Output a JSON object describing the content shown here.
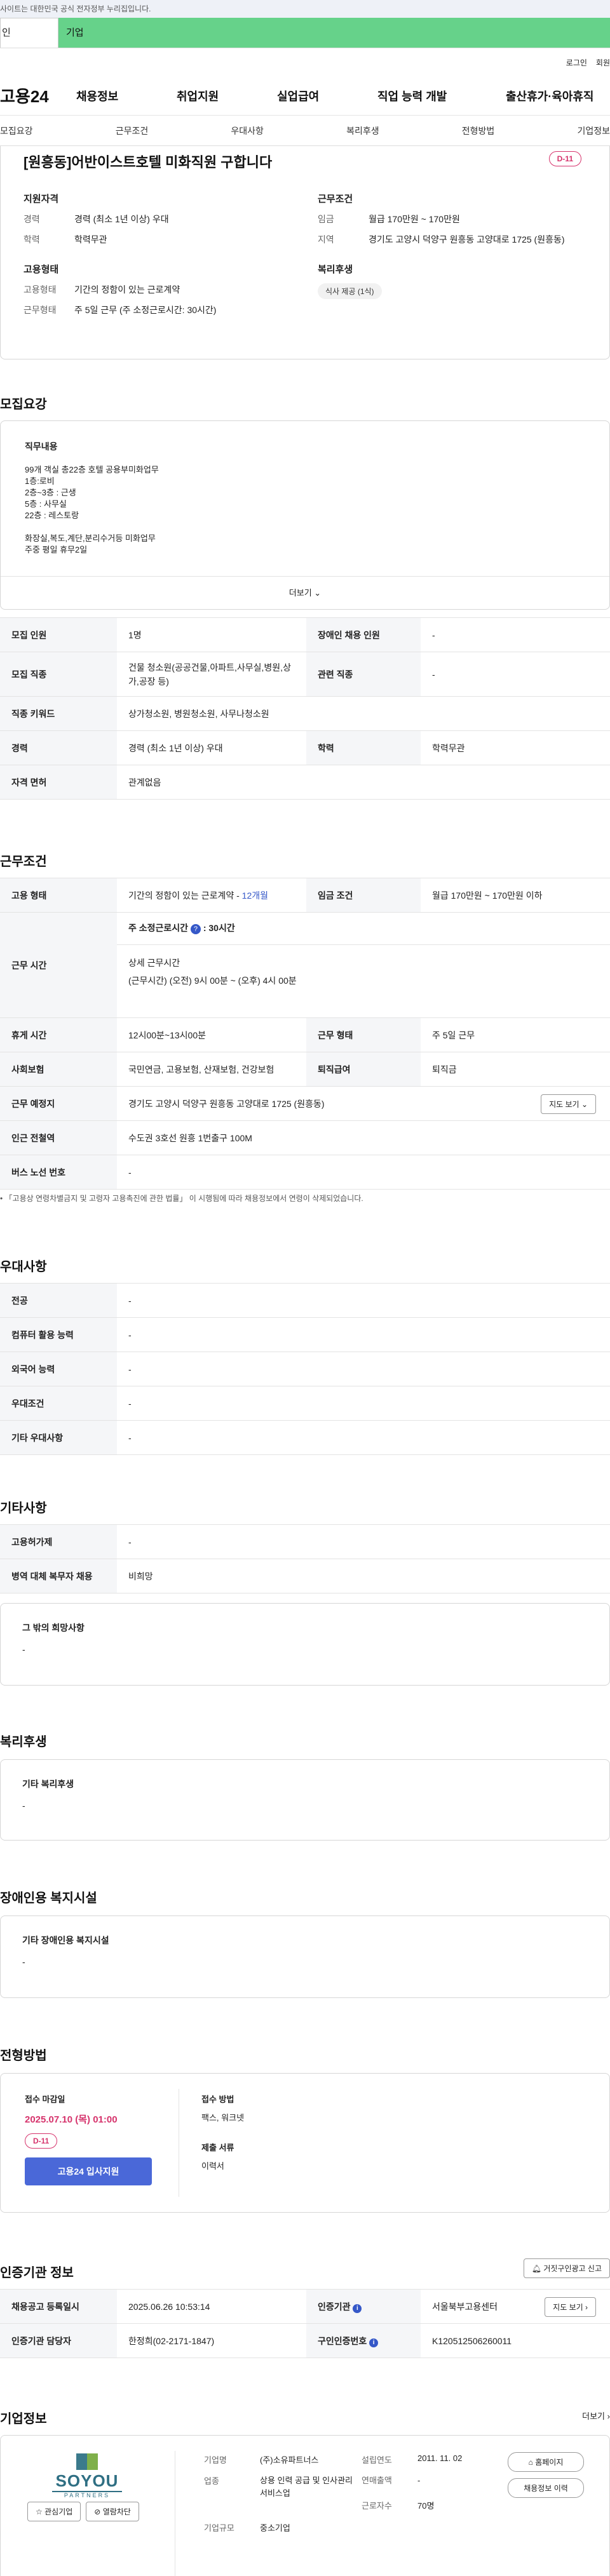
{
  "topbar": {
    "notice": "사이트는 대한민국 공식 전자정부 누리집입니다."
  },
  "tabs": {
    "t1": "인",
    "t2": "기업"
  },
  "util": {
    "login": "로그인",
    "join": "회원"
  },
  "gnb": {
    "logo": "고용24",
    "items": [
      "채용정보",
      "취업지원",
      "실업급여",
      "직업 능력 개발",
      "출산휴가·육아휴직"
    ]
  },
  "subnav": [
    "모집요강",
    "근무조건",
    "우대사항",
    "복리후생",
    "전형방법",
    "기업정보"
  ],
  "header": {
    "title": "[원흥동]어반이스트호텔 미화직원 구합니다",
    "dday": "D-11",
    "qual_title": "지원자격",
    "career_k": "경력",
    "career_v": "경력 (최소 1년 이상) 우대",
    "edu_k": "학력",
    "edu_v": "학력무관",
    "cond_title": "근무조건",
    "wage_k": "임금",
    "wage_v": "월급 170만원 ~ 170만원",
    "region_k": "지역",
    "region_v": "경기도 고양시 덕양구 원흥동 고양대로 1725 (원흥동)",
    "emp_title": "고용형태",
    "emptype_k": "고용형태",
    "emptype_v": "기간의 정함이 있는 근로계약",
    "worktype_k": "근무형태",
    "worktype_v": "주 5일 근무 (주 소정근로시간: 30시간)",
    "welfare_title": "복리후생",
    "welfare_chip": "식사 제공 (1식)"
  },
  "recruit": {
    "title": "모집요강",
    "duty_title": "직무내용",
    "duty_lines": [
      "99개 객실 총22층 호텔 공용부미화업무",
      "1층:로비",
      "2층~3층 : 근생",
      "5층 : 사무실",
      "22층 : 레스토랑",
      "",
      "화장실,복도,계단,분리수거등 미화업무",
      "주중 평일 휴무2일"
    ],
    "more": "더보기",
    "rows": {
      "count_k": "모집 인원",
      "count_v": "1명",
      "disab_k": "장애인 채용 인원",
      "disab_v": "-",
      "job_k": "모집 직종",
      "job_v": "건물 청소원(공공건물,아파트,사무실,병원,상가,공장 등)",
      "rel_k": "관련 직종",
      "rel_v": "-",
      "kw_k": "직종 키워드",
      "kw_v": "상가청소원, 병원청소원, 사무나청소원",
      "career_k": "경력",
      "career_v": "경력 (최소 1년 이상) 우대",
      "edu_k": "학력",
      "edu_v": "학력무관",
      "lic_k": "자격 면허",
      "lic_v": "관계없음"
    }
  },
  "work": {
    "title": "근무조건",
    "emp_k": "고용 형태",
    "emp_v": "기간의 정함이 있는 근로계약 - ",
    "emp_months": "12개월",
    "wage_k": "임금 조건",
    "wage_v": "월급 170만원 ~ 170만원 이하",
    "hours_k": "근무 시간",
    "hours_std": "주 소정근로시간",
    "hours_std_v": ": 30시간",
    "hours_detail_t": "상세 근무시간",
    "hours_detail_v": "(근무시간) (오전) 9시 00분 ~ (오후) 4시 00분",
    "rest_k": "휴게 시간",
    "rest_v": "12시00분~13시00분",
    "form_k": "근무 형태",
    "form_v": "주 5일 근무",
    "ins_k": "사회보험",
    "ins_v": "국민연금, 고용보험, 산재보험, 건강보험",
    "sev_k": "퇴직급여",
    "sev_v": "퇴직금",
    "loc_k": "근무 예정지",
    "loc_v": "경기도 고양시 덕양구 원흥동 고양대로 1725 (원흥동)",
    "map_btn": "지도 보기",
    "sub_k": "인근 전철역",
    "sub_v": "수도권 3호선 원흥 1번출구 100M",
    "bus_k": "버스 노선 번호",
    "bus_v": "-",
    "note": "「고용상 연령차별금지 및 고령자 고용촉진에 관한 법률」 이 시행됨에 따라 채용정보에서 연령이 삭제되었습니다."
  },
  "pref": {
    "title": "우대사항",
    "rows": [
      [
        "전공",
        "-"
      ],
      [
        "컴퓨터 활용 능력",
        "-"
      ],
      [
        "외국어 능력",
        "-"
      ],
      [
        "우대조건",
        "-"
      ],
      [
        "기타 우대사항",
        "-"
      ]
    ]
  },
  "etc": {
    "title": "기타사항",
    "rows": [
      [
        "고용허가제",
        "-"
      ],
      [
        "병역 대체 복무자 채용",
        "비희망"
      ]
    ],
    "hope_title": "그 밖의 희망사항",
    "hope_v": "-"
  },
  "welfare": {
    "title": "복리후생",
    "box_title": "기타 복리후생",
    "box_v": "-"
  },
  "disab": {
    "title": "장애인용 복지시설",
    "box_title": "기타 장애인용 복지시설",
    "box_v": "-"
  },
  "process": {
    "title": "전형방법",
    "deadline_t": "접수 마감일",
    "deadline_v": "2025.07.10 (목) 01:00",
    "dday": "D-11",
    "apply_btn": "고용24 입사지원",
    "method_t": "접수 방법",
    "method_v": "팩스, 워크넷",
    "docs_t": "제출 서류",
    "docs_v": "이력서"
  },
  "cert": {
    "title": "인증기관 정보",
    "report_btn": "거짓구인광고 신고",
    "reg_k": "채용공고 등록일시",
    "reg_v": "2025.06.26 10:53:14",
    "org_k": "인증기관",
    "org_v": "서울북부고용센터",
    "map_btn": "지도 보기",
    "mgr_k": "인증기관 담당자",
    "mgr_v": "한정희(02-2171-1847)",
    "num_k": "구인인증번호",
    "num_v": "K120512506260011"
  },
  "company": {
    "title": "기업정보",
    "more": "더보기",
    "logo_text": "SOYOU",
    "logo_sub": "PARTNERS",
    "fav_btn": "관심기업",
    "block_btn": "열람차단",
    "name_k": "기업명",
    "name_v": "(주)소유파트너스",
    "est_k": "설립연도",
    "est_v": "2011. 11. 02",
    "biz_k": "업종",
    "biz_v": "상용 인력 공급 및 인사관리 서비스업",
    "sales_k": "연매출액",
    "sales_v": "-",
    "emp_k": "근로자수",
    "emp_v": "70명",
    "size_k": "기업규모",
    "size_v": "중소기업",
    "home_btn": "홈페이지",
    "jobs_btn": "채용정보 이력"
  },
  "colors": {
    "green_tab": "#66d28a",
    "dday": "#d6336c",
    "apply": "#4a68d8",
    "link_blue": "#3558c8"
  }
}
